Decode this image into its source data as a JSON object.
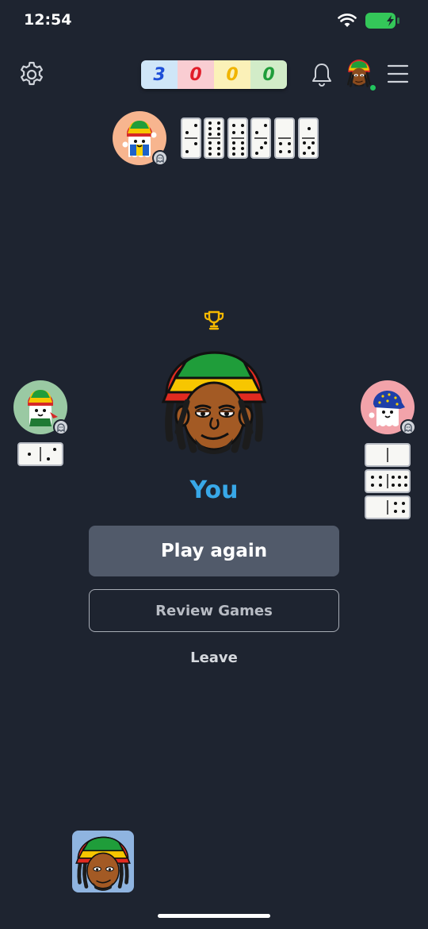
{
  "status_bar": {
    "time": "12:54",
    "icons": [
      "wifi-icon",
      "battery-charging-icon"
    ],
    "battery_color": "#34c759"
  },
  "top_bar": {
    "settings_icon": "gear-icon",
    "bell_icon": "bell-icon",
    "menu_icon": "hamburger-menu-icon",
    "scores": [
      {
        "value": "3",
        "bg": "#cfe6f8",
        "color": "#1d4fd8"
      },
      {
        "value": "0",
        "bg": "#f9cdd2",
        "color": "#e11d2a"
      },
      {
        "value": "0",
        "bg": "#fbf1b8",
        "color": "#f0b400"
      },
      {
        "value": "0",
        "bg": "#d2ecc8",
        "color": "#1f9d3a"
      }
    ]
  },
  "players": {
    "top": {
      "avatar": "ghost-rasta-avatar",
      "bot": true,
      "tiles": 6
    },
    "left": {
      "avatar": "ghost-rasta-green-avatar",
      "bot": true,
      "tiles": 1
    },
    "right": {
      "avatar": "ghost-eu-avatar",
      "bot": true,
      "tiles": 3
    }
  },
  "winner": {
    "trophy_icon": "trophy-icon",
    "avatar": "rasta-man-avatar",
    "name": "You"
  },
  "actions": {
    "play_again": "Play again",
    "review_games": "Review Games",
    "leave": "Leave"
  },
  "colors": {
    "background": "#1e2430",
    "accent_blue": "#38a8e8",
    "trophy": "#f5b800"
  }
}
